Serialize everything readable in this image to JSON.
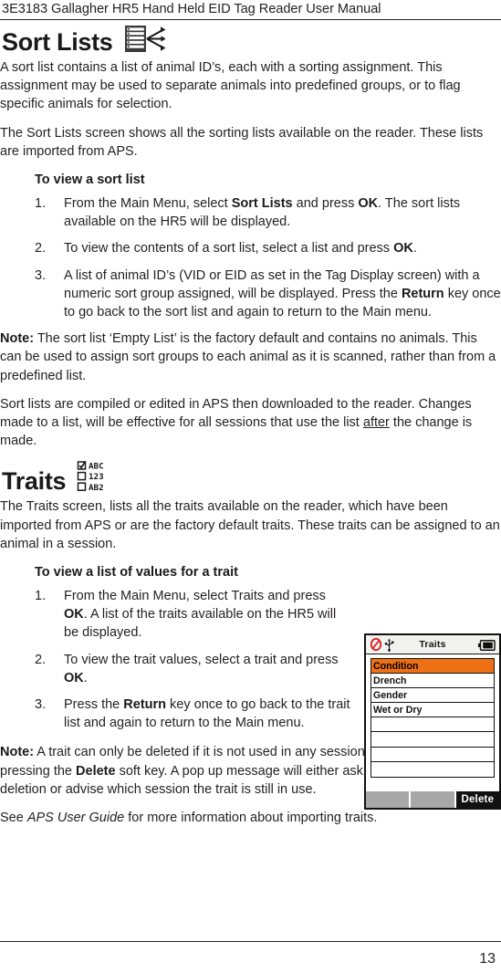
{
  "header": {
    "running_head": "3E3183 Gallagher HR5 Hand Held EID Tag Reader User Manual"
  },
  "footer": {
    "page_number": "13"
  },
  "sections": [
    {
      "id": "sort-lists",
      "title": "Sort Lists",
      "icon": "sort-list-icon",
      "intro_1": "A sort list contains a list of  animal ID’s, each with a sorting assignment. This assignment may be used to separate animals into predefined groups, or to flag specific animals for selection.",
      "intro_2": "The Sort Lists screen shows all the sorting lists available on the reader. These lists are imported from APS.",
      "procedure_heading": "To view a sort list",
      "steps": [
        {
          "num": "1.",
          "parts": [
            {
              "t": "From the Main Menu, select ",
              "b": false
            },
            {
              "t": "Sort Lists",
              "b": true
            },
            {
              "t": " and press ",
              "b": false
            },
            {
              "t": "OK",
              "b": true
            },
            {
              "t": ". The sort lists available on the HR5 will be displayed.",
              "b": false
            }
          ]
        },
        {
          "num": "2.",
          "parts": [
            {
              "t": "To view the contents of a sort list, select a list and press ",
              "b": false
            },
            {
              "t": "OK",
              "b": true
            },
            {
              "t": ".",
              "b": false
            }
          ]
        },
        {
          "num": "3.",
          "parts": [
            {
              "t": "A list of animal ID’s (VID or EID as set in the Tag Display screen) with a numeric sort group assigned, will be displayed. Press the ",
              "b": false
            },
            {
              "t": "Return",
              "b": true
            },
            {
              "t": " key once to go back to the sort list and again to return to the Main menu.",
              "b": false
            }
          ]
        }
      ],
      "note_label": "Note:",
      "note_text": " The sort list ‘Empty List’ is the factory default and contains no  animals. This can be used to assign sort groups to each animal as it is scanned, rather than from a predefined list.",
      "closing_pre": "Sort lists are compiled or edited in APS then downloaded to the reader. Changes made to a list, will be effective for all sessions that use the list ",
      "closing_underlined": "after",
      "closing_post": " the change is made."
    },
    {
      "id": "traits",
      "title": "Traits",
      "icon": "traits-checklist-icon",
      "icon_rows": [
        {
          "checked": true,
          "label": "ABC"
        },
        {
          "checked": false,
          "label": "123"
        },
        {
          "checked": false,
          "label": "AB2"
        }
      ],
      "intro_1": "The Traits screen, lists all the traits available on the reader, which have been imported from APS or are the factory default traits. These traits can be assigned to an animal in a session.",
      "procedure_heading": "To view a list of values for a trait",
      "steps": [
        {
          "num": "1.",
          "parts": [
            {
              "t": "From the Main Menu, select Traits and press ",
              "b": false
            },
            {
              "t": "OK",
              "b": true
            },
            {
              "t": ". A list of the traits  available on the HR5 will be displayed.",
              "b": false
            }
          ]
        },
        {
          "num": "2.",
          "parts": [
            {
              "t": "To view the trait values, select a trait and press ",
              "b": false
            },
            {
              "t": "OK",
              "b": true
            },
            {
              "t": ".",
              "b": false
            }
          ]
        },
        {
          "num": "3.",
          "parts": [
            {
              "t": "Press the ",
              "b": false
            },
            {
              "t": "Return",
              "b": true
            },
            {
              "t": " key once to go back to the trait list and again to return to the Main menu.",
              "b": false
            }
          ]
        }
      ],
      "note_label": "Note:",
      "note_parts": [
        {
          "t": " A trait can only be deleted if it is not used in any session on the reader, by pressing the ",
          "b": false
        },
        {
          "t": "Delete",
          "b": true
        },
        {
          "t": " soft key. A pop up message will either ask you to confirm the deletion or advise which session the trait is still in use.",
          "b": false
        }
      ],
      "see_pre": "See ",
      "see_italic": "APS User Guide",
      "see_post": " for more information about importing traits."
    }
  ],
  "device_screenshot": {
    "title": "Traits",
    "status_icons": [
      "no-signal-icon",
      "usb-icon",
      "battery-icon"
    ],
    "rows": [
      {
        "label": "Condition",
        "selected": true
      },
      {
        "label": "Drench",
        "selected": false
      },
      {
        "label": "Gender",
        "selected": false
      },
      {
        "label": "Wet or Dry",
        "selected": false
      },
      {
        "label": "",
        "selected": false
      },
      {
        "label": "",
        "selected": false
      },
      {
        "label": "",
        "selected": false
      },
      {
        "label": "",
        "selected": false
      }
    ],
    "softkeys": [
      {
        "label": "",
        "style": "blank"
      },
      {
        "label": "",
        "style": "blank"
      },
      {
        "label": "Delete",
        "style": "dark"
      }
    ],
    "colors": {
      "selected_row": "#EE7014",
      "softkey_blank": "#A8A8A8",
      "softkey_dark": "#111111"
    }
  }
}
